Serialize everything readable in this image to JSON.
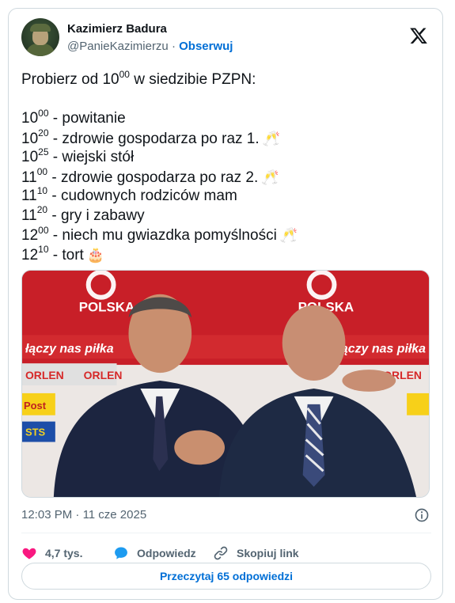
{
  "author": {
    "name": "Kazimierz Badura",
    "handle": "@PanieKazimierzu",
    "separator": "·",
    "follow_label": "Obserwuj"
  },
  "tweet": {
    "intro_prefix": "Probierz od 10",
    "intro_sup": "00",
    "intro_suffix": " w siedzibie PZPN:",
    "schedule": [
      {
        "hour": "10",
        "min": "00",
        "text": " - powitanie",
        "emoji": ""
      },
      {
        "hour": "10",
        "min": "20",
        "text": " - zdrowie gospodarza po raz 1.",
        "emoji": "🥂"
      },
      {
        "hour": "10",
        "min": "25",
        "text": " - wiejski stół",
        "emoji": ""
      },
      {
        "hour": "11",
        "min": "00",
        "text": " - zdrowie gospodarza po raz 2.",
        "emoji": "🥂"
      },
      {
        "hour": "11",
        "min": "10",
        "text": " - cudownych rodziców mam",
        "emoji": ""
      },
      {
        "hour": "11",
        "min": "20",
        "text": " - gry i zabawy",
        "emoji": ""
      },
      {
        "hour": "12",
        "min": "00",
        "text": " - niech mu gwiazdka pomyślności",
        "emoji": "🥂"
      },
      {
        "hour": "12",
        "min": "10",
        "text": " - tort",
        "emoji": "🎂"
      }
    ]
  },
  "photo": {
    "logo_text": "POLSKA",
    "banner_text": "łączy nas piłka",
    "sponsor_orlen": "ORLEN",
    "sponsor_post": "Post",
    "sponsor_sts": "STS"
  },
  "meta": {
    "time": "12:03 PM",
    "separator": "·",
    "date": "11 cze 2025"
  },
  "actions": {
    "likes": "4,7 tys.",
    "reply": "Odpowiedz",
    "copy_link": "Skopiuj link"
  },
  "read_more": "Przeczytaj 65 odpowiedzi",
  "colors": {
    "accent": "#006fd6",
    "like": "#f91880",
    "reply": "#1d9bf0",
    "text_secondary": "#536471"
  }
}
